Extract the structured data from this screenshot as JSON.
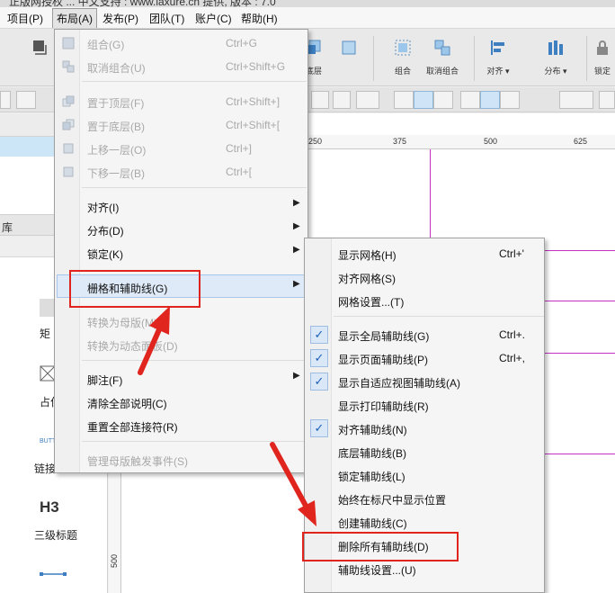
{
  "title": {
    "text": "正版网授权 ... 中文支持 : www.iaxure.cn 提供, 版本 : 7.0"
  },
  "menubar": {
    "items": [
      {
        "id": "project",
        "label": "项目(P)"
      },
      {
        "id": "layout",
        "label": "布局(A)"
      },
      {
        "id": "publish",
        "label": "发布(P)"
      },
      {
        "id": "team",
        "label": "团队(T)"
      },
      {
        "id": "account",
        "label": "账户(C)"
      },
      {
        "id": "help",
        "label": "帮助(H)"
      }
    ]
  },
  "toolbar": {
    "buttons": [
      {
        "id": "bottom",
        "label": "底层"
      },
      {
        "id": "group",
        "label": "组合"
      },
      {
        "id": "ungroup",
        "label": "取消组合"
      },
      {
        "id": "align",
        "label": "对齐 ▾"
      },
      {
        "id": "distribute",
        "label": "分布 ▾"
      },
      {
        "id": "lock",
        "label": "锁定"
      }
    ]
  },
  "left_panel": {
    "section_label": "库",
    "widgets": [
      {
        "label": "矩"
      },
      {
        "label": "占位"
      },
      {
        "label": "链接",
        "tag": "BUTTON"
      },
      {
        "label": "三级标题",
        "tag": "H3"
      }
    ]
  },
  "rulers": {
    "top": [
      "250",
      "375",
      "500",
      "625"
    ],
    "left": [
      "500"
    ]
  },
  "layout_menu": {
    "items": [
      {
        "label": "组合(G)",
        "shortcut": "Ctrl+G",
        "disabled": true,
        "icon": "group-icon"
      },
      {
        "label": "取消组合(U)",
        "shortcut": "Ctrl+Shift+G",
        "disabled": true,
        "icon": "ungroup-icon"
      },
      {
        "label": "置于顶层(F)",
        "shortcut": "Ctrl+Shift+]",
        "disabled": true,
        "icon": "bring-front-icon"
      },
      {
        "label": "置于底层(B)",
        "shortcut": "Ctrl+Shift+[",
        "disabled": true,
        "icon": "send-back-icon"
      },
      {
        "label": "上移一层(O)",
        "shortcut": "Ctrl+]",
        "disabled": true,
        "icon": "bring-forward-icon"
      },
      {
        "label": "下移一层(B)",
        "shortcut": "Ctrl+[",
        "disabled": true,
        "icon": "send-backward-icon"
      },
      {
        "label": "对齐(I)",
        "submenu": true
      },
      {
        "label": "分布(D)",
        "submenu": true
      },
      {
        "label": "锁定(K)",
        "submenu": true
      },
      {
        "label": "栅格和辅助线(G)",
        "submenu": true,
        "highlighted": true
      },
      {
        "label": "转换为母版(M)",
        "disabled": true
      },
      {
        "label": "转换为动态面板(D)",
        "disabled": true
      },
      {
        "label": "脚注(F)",
        "submenu": true
      },
      {
        "label": "清除全部说明(C)"
      },
      {
        "label": "重置全部连接符(R)"
      },
      {
        "label": "管理母版触发事件(S)",
        "disabled": true
      }
    ]
  },
  "grid_submenu": {
    "items": [
      {
        "label": "显示网格(H)",
        "shortcut": "Ctrl+'",
        "checked": false
      },
      {
        "label": "对齐网格(S)",
        "checked": false
      },
      {
        "label": "网格设置...(T)",
        "checked": false
      },
      {
        "label": "显示全局辅助线(G)",
        "shortcut": "Ctrl+.",
        "checked": true
      },
      {
        "label": "显示页面辅助线(P)",
        "shortcut": "Ctrl+,",
        "checked": true
      },
      {
        "label": "显示自适应视图辅助线(A)",
        "checked": true
      },
      {
        "label": "显示打印辅助线(R)",
        "checked": false
      },
      {
        "label": "对齐辅助线(N)",
        "checked": true
      },
      {
        "label": "底层辅助线(B)",
        "checked": false
      },
      {
        "label": "锁定辅助线(L)",
        "checked": false
      },
      {
        "label": "始终在标尺中显示位置",
        "checked": false
      },
      {
        "label": "创建辅助线(C)",
        "checked": false
      },
      {
        "label": "删除所有辅助线(D)",
        "checked": false,
        "highlighted": true
      },
      {
        "label": "辅助线设置...(U)",
        "checked": false
      }
    ]
  },
  "colors": {
    "guide": "#c233c2",
    "annotation": "#e0251f",
    "check_mark": "#1b5fb8"
  }
}
